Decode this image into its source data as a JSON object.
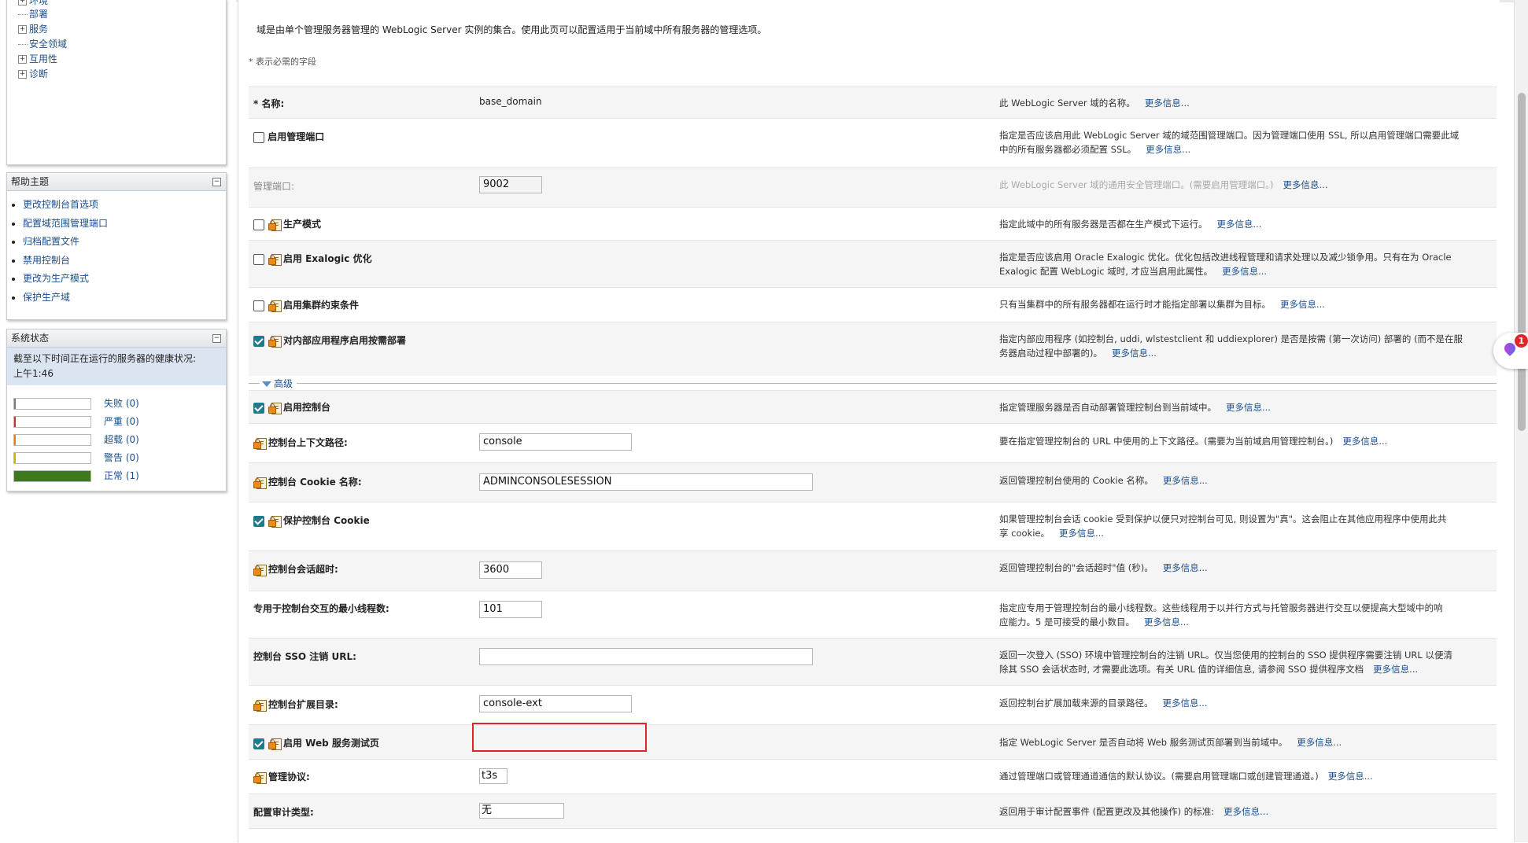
{
  "sidebar": {
    "tree": [
      "环境",
      "部署",
      "服务",
      "安全领域",
      "互用性",
      "诊断"
    ],
    "help": {
      "title": "帮助主题",
      "items": [
        "更改控制台首选项",
        "配置域范围管理端口",
        "归档配置文件",
        "禁用控制台",
        "更改为生产模式",
        "保护生产域"
      ]
    },
    "status": {
      "title": "系统状态",
      "desc_line1": "截至以下时间正在运行的服务器的健康状况:",
      "desc_line2": "上午1:46",
      "rows": [
        {
          "label": "失败 (0)",
          "color": "#7a7a7a",
          "fill": 0
        },
        {
          "label": "严重 (0)",
          "color": "#c0392b",
          "fill": 0
        },
        {
          "label": "超载 (0)",
          "color": "#e67e22",
          "fill": 0
        },
        {
          "label": "警告 (0)",
          "color": "#d4b000",
          "fill": 0
        },
        {
          "label": "正常 (1)",
          "color": "#3f7a1a",
          "fill": 1
        }
      ]
    }
  },
  "main": {
    "intro": "域是由单个管理服务器管理的 WebLogic Server 实例的集合。使用此页可以配置适用于当前域中所有服务器的管理选项。",
    "required_note": "* 表示必需的字段",
    "more_info": "更多信息...",
    "advanced_label": "高级",
    "fields": {
      "name": {
        "label": "* 名称:",
        "value": "base_domain",
        "desc": "此 WebLogic Server 域的名称。"
      },
      "admin_port_enabled": {
        "label": "启用管理端口",
        "desc1": "指定是否应该启用此 WebLogic Server 域的域范围管理端口。因为管理端口使用 SSL, 所以启用管理端口需要此域",
        "desc2": "中的所有服务器都必须配置 SSL。"
      },
      "admin_port": {
        "label": "管理端口:",
        "value": "9002",
        "desc": "此 WebLogic Server 域的通用安全管理端口。(需要启用管理端口。)"
      },
      "production_mode": {
        "label": "生产模式",
        "desc": "指定此域中的所有服务器是否都在生产模式下运行。"
      },
      "exalogic": {
        "label": "启用 Exalogic 优化",
        "desc1": "指定是否应该启用 Oracle Exalogic 优化。优化包括改进线程管理和请求处理以及减少锁争用。只有在为 Oracle",
        "desc2": "Exalogic 配置 WebLogic 域时, 才应当启用此属性。"
      },
      "cluster_constraints": {
        "label": "启用集群约束条件",
        "desc": "只有当集群中的所有服务器都在运行时才能指定部署以集群为目标。"
      },
      "on_demand": {
        "label": "对内部应用程序启用按需部署",
        "desc1": "指定内部应用程序 (如控制台, uddi, wlstestclient 和 uddiexplorer) 是否是按需 (第一次访问) 部署的 (而不是在服",
        "desc2": "务器启动过程中部署的)。"
      },
      "console_enabled": {
        "label": "启用控制台",
        "desc": "指定管理服务器是否自动部署管理控制台到当前域中。"
      },
      "context_path": {
        "label": "控制台上下文路径:",
        "value": "console",
        "desc": "要在指定管理控制台的 URL 中使用的上下文路径。(需要为当前域启用管理控制台。)"
      },
      "cookie_name": {
        "label": "控制台 Cookie 名称:",
        "value": "ADMINCONSOLESESSION",
        "desc": "返回管理控制台使用的 Cookie 名称。"
      },
      "protect_cookie": {
        "label": "保护控制台 Cookie",
        "desc1": "如果管理控制台会话 cookie 受到保护以便只对控制台可见, 则设置为\"真\"。这会阻止在其他应用程序中使用此共",
        "desc2": "享 cookie。"
      },
      "session_timeout": {
        "label": "控制台会话超时:",
        "value": "3600",
        "desc": "返回管理控制台的\"会话超时\"值 (秒)。"
      },
      "min_threads": {
        "label": "专用于控制台交互的最小线程数:",
        "value": "101",
        "desc1": "指定应专用于管理控制台的最小线程数。这些线程用于以并行方式与托管服务器进行交互以便提高大型域中的响",
        "desc2": "应能力。5 是可接受的最小数目。"
      },
      "sso_logout": {
        "label": "控制台 SSO 注销 URL:",
        "value": "",
        "desc1": "返回一次登入 (SSO) 环境中管理控制台的注销 URL。仅当您使用的控制台的 SSO 提供程序需要注销 URL 以便清",
        "desc2": "除其 SSO 会话状态时, 才需要此选项。有关 URL 值的详细信息, 请参阅 SSO 提供程序文档"
      },
      "ext_dir": {
        "label": "控制台扩展目录:",
        "value": "console-ext",
        "desc": "返回控制台扩展加载来源的目录路径。"
      },
      "ws_test_page": {
        "label": "启用 Web 服务测试页",
        "desc": "指定 WebLogic Server 是否自动将 Web 服务测试页部署到当前域中。"
      },
      "protocol": {
        "label": "管理协议:",
        "value": "t3s",
        "desc": "通过管理端口或管理通道通信的默认协议。(需要启用管理端口或创建管理通道。)"
      },
      "audit_type": {
        "label": "配置审计类型:",
        "value": "无",
        "desc": "返回用于审计配置事件 (配置更改及其他操作) 的标准:"
      }
    }
  },
  "notification": {
    "count": "1"
  },
  "colors": {
    "link": "#1a4e8c",
    "highlight": "#e0252b",
    "checked": "#1e7b8c"
  }
}
